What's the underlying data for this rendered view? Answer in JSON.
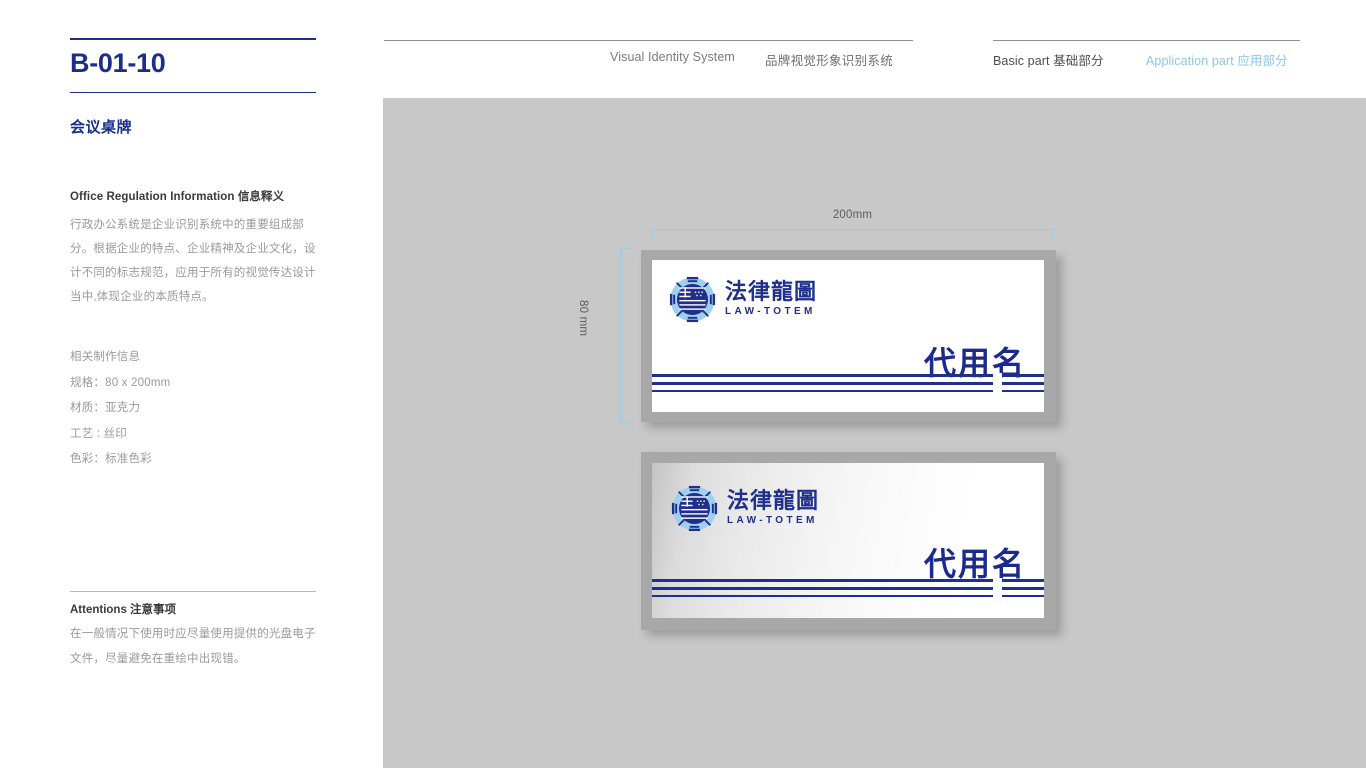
{
  "left_panel": {
    "page_code": "B-01-10",
    "section_title": "会议桌牌",
    "info_heading": "Office Regulation Information  信息释义",
    "info_body": "行政办公系统是企业识别系统中的重要组成部分。根据企业的特点、企业精神及企业文化，设计不同的标志规范，应用于所有的视觉传达设计当中,体现企业的本质特点。",
    "spec_heading": "相关制作信息",
    "specs": [
      "规格：80 x 200mm",
      "材质：亚克力",
      "工艺 : 丝印",
      "色彩：标准色彩"
    ],
    "attentions_heading": "Attentions 注意事项",
    "attentions_body": "在一般情况下使用时应尽量使用提供的光盘电子文件，尽量避免在重绘中出现错。"
  },
  "header": {
    "vis_en": "Visual Identity System",
    "vis_cn": "品牌视觉形象识别系统",
    "basic_part": "Basic part  基础部分",
    "application_part": "Application part  应用部分"
  },
  "dimensions": {
    "width_label": "200mm",
    "height_label": "80 mm"
  },
  "brand": {
    "wordmark_cn": "法律龍圖",
    "wordmark_en": "LAW-TOTEM",
    "placeholder_name": "代用名"
  },
  "colors": {
    "brand_blue": "#1f2f8c",
    "accent_light_blue": "#8fc4e8",
    "stage_gray": "#c8c8c8",
    "card_frame_gray": "#a8a8a8",
    "body_text_gray": "#9a9a9a"
  }
}
